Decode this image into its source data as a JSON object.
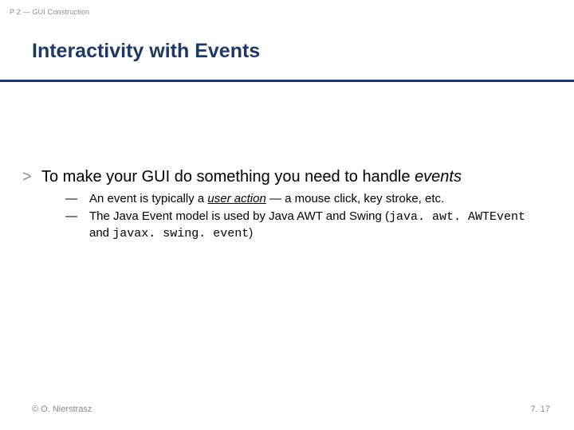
{
  "header": {
    "label": "P 2 — GUI Construction"
  },
  "title": "Interactivity with Events",
  "bullets": {
    "lvl1_marker": ">",
    "lvl1_text_a": "To make your GUI do something you need to handle ",
    "lvl1_text_b_em": "events",
    "lvl2_marker": "—",
    "lvl2_1_a": "An event is typically a ",
    "lvl2_1_b_emu": "user action",
    "lvl2_1_c": " — a mouse click, key stroke, etc.",
    "lvl2_2_a": "The Java Event model is used by Java AWT and Swing (",
    "lvl2_2_b_code": "java. awt. AWTEvent",
    "lvl2_2_c": " and ",
    "lvl2_2_d_code": "javax. swing. event",
    "lvl2_2_e": ")"
  },
  "footer": {
    "left": "© O. Nierstrasz",
    "right": "7. 17"
  }
}
